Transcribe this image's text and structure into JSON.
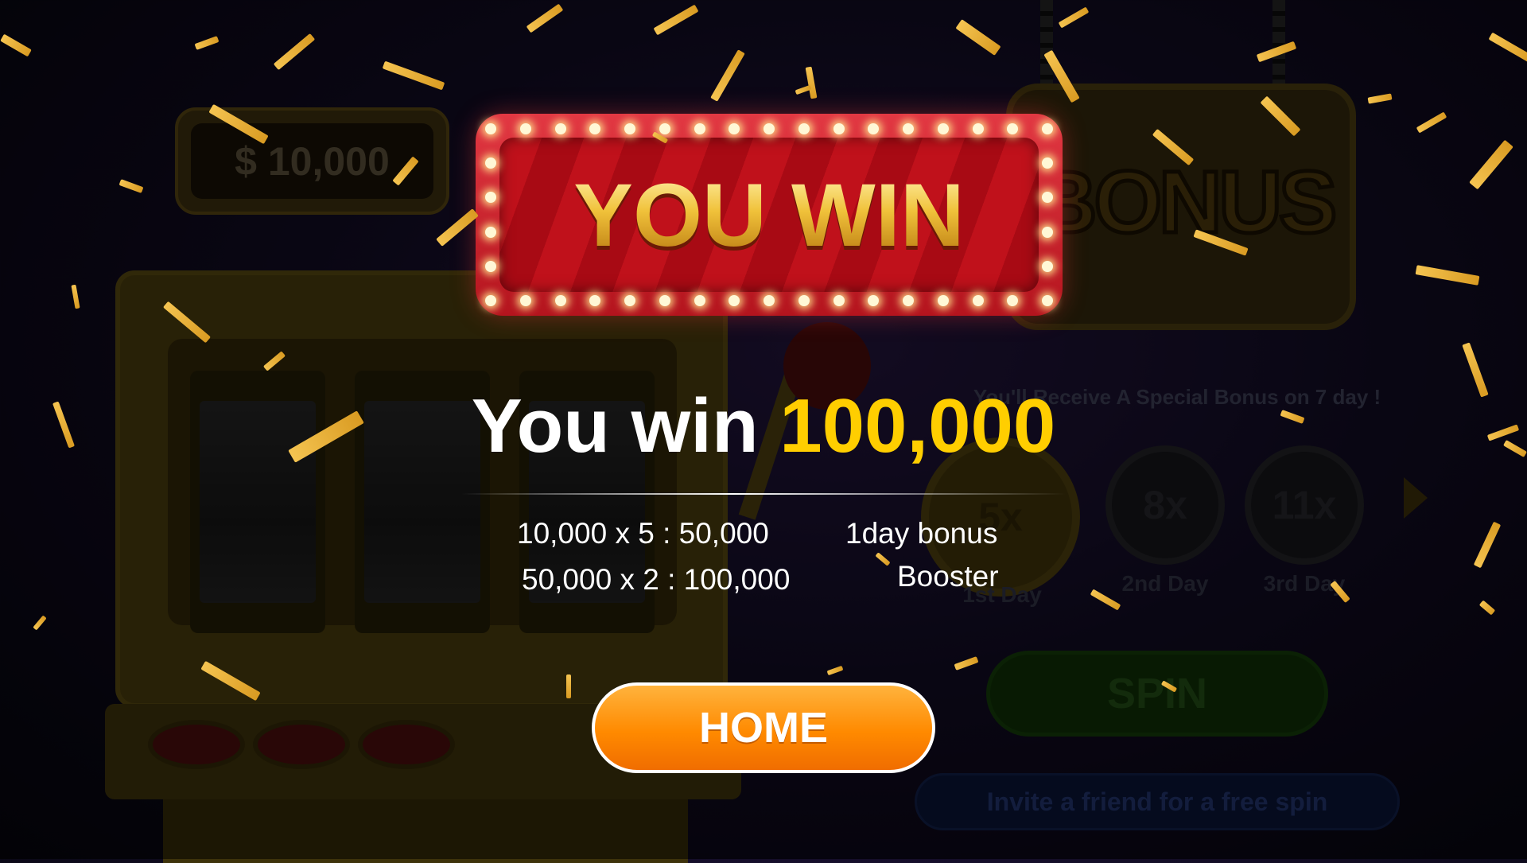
{
  "balance": {
    "text": "$ 10,000"
  },
  "bonus_sign": {
    "text": "BONUS"
  },
  "bonus_note": {
    "text": "You'll Receive A Special Bonus on 7 day !"
  },
  "days": [
    {
      "multiplier": "5x",
      "label": "1st Day"
    },
    {
      "multiplier": "8x",
      "label": "2nd Day"
    },
    {
      "multiplier": "11x",
      "label": "3rd Day"
    }
  ],
  "spin_button": {
    "label": "SPIN"
  },
  "invite_button": {
    "label": "Invite a friend for a free spin"
  },
  "popup": {
    "title": "YOU WIN",
    "win_prefix": "You win",
    "win_amount": "100,000",
    "calc_lines": [
      {
        "formula": "10,000 x 5 : 50,000",
        "note": "1day bonus"
      },
      {
        "formula": "50,000 x 2 : 100,000",
        "note": "Booster"
      }
    ],
    "home_label": "HOME"
  },
  "colors": {
    "accent_gold": "#ffce00",
    "marquee_red": "#c0111b",
    "home_orange": "#ff8a00"
  }
}
